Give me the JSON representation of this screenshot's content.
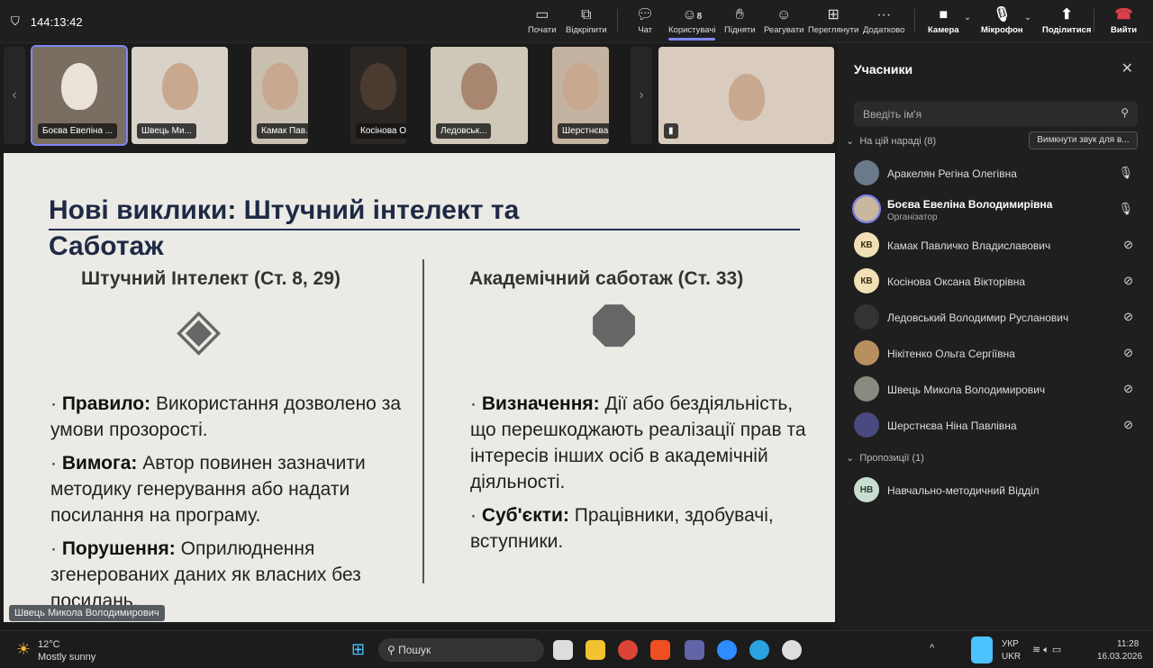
{
  "topbar": {
    "timer": "144:13:42",
    "buttons": [
      {
        "label": "Почати",
        "icon": "share-screen-icon"
      },
      {
        "label": "Відкріпити",
        "icon": "popout-icon"
      },
      {
        "label": "Чат",
        "icon": "chat-icon"
      },
      {
        "label": "Користувачі",
        "icon": "people-icon",
        "badge": "8"
      },
      {
        "label": "Підняти",
        "icon": "raise-hand-icon"
      },
      {
        "label": "Реагувати",
        "icon": "react-icon"
      },
      {
        "label": "Переглянути",
        "icon": "view-icon"
      },
      {
        "label": "Додатково",
        "icon": "more-icon"
      },
      {
        "label": "Камера",
        "icon": "camera-icon"
      },
      {
        "label": "Мікрофон",
        "icon": "mic-icon"
      },
      {
        "label": "Поділитися",
        "icon": "share-icon"
      },
      {
        "label": "Вийти",
        "icon": "leave-icon"
      }
    ]
  },
  "tiles": [
    "Боєва Евеліна ...",
    "Швець Ми...",
    "Камак Пав...",
    "Косінова О...",
    "Ледовськ...",
    "Шерстнєва..."
  ],
  "slide": {
    "title1": "Нові виклики: Штучний інтелект та",
    "title2": "Саботаж",
    "left_heading": "Штучний Інтелект (Ст. 8, 29)",
    "right_heading": "Академічний саботаж (Ст. 33)",
    "left": [
      {
        "k": "Правило:",
        "v": " Використання дозволено за умови прозорості."
      },
      {
        "k": "Вимога:",
        "v": " Автор повинен зазначити методику генерування або надати посилання на програму."
      },
      {
        "k": "Порушення:",
        "v": " Оприлюднення згенерованих даних як власних без посилань."
      }
    ],
    "right": [
      {
        "k": "Визначення:",
        "v": " Дії або бездіяльність, що перешкоджають реалізації прав та інтересів інших осіб в академічній діяльності."
      },
      {
        "k": "Суб'єкти:",
        "v": " Працівники, здобувачі, вступники."
      }
    ],
    "speaker": "Швець Микола Володимирович"
  },
  "panel": {
    "title": "Учасники",
    "search_placeholder": "Введіть ім'я",
    "in_meeting": "На цій нараді (8)",
    "mute_all": "Вимкнути звук для в...",
    "people": [
      {
        "name": "Аракелян Регіна Олегівна",
        "initials": "",
        "mic": "on"
      },
      {
        "name": "Боєва Евеліна Володимирівна",
        "role": "Організатор",
        "initials": "",
        "mic": "on"
      },
      {
        "name": "Камак Павличко Владиславович",
        "initials": "КВ",
        "mic": "off"
      },
      {
        "name": "Косінова Оксана Вікторівна",
        "initials": "КВ",
        "mic": "off"
      },
      {
        "name": "Ледовський Володимир Русланович",
        "initials": "",
        "mic": "off"
      },
      {
        "name": "Нікітенко Ольга Сергіївна",
        "initials": "",
        "mic": "off"
      },
      {
        "name": "Швець Микола Володимирович",
        "initials": "",
        "mic": "off"
      },
      {
        "name": "Шерстнєва Ніна Павлівна",
        "initials": "",
        "mic": "off"
      }
    ],
    "suggestions": "Пропозиції (1)",
    "suggested": {
      "name": "Навчально-методичний Відділ",
      "initials": "НВ"
    }
  },
  "taskbar": {
    "temp": "12°C",
    "weather": "Mostly sunny",
    "search": "Пошук",
    "lang1": "УКР",
    "lang2": "UKR",
    "time": "11:28",
    "date": "16.03.2026"
  }
}
